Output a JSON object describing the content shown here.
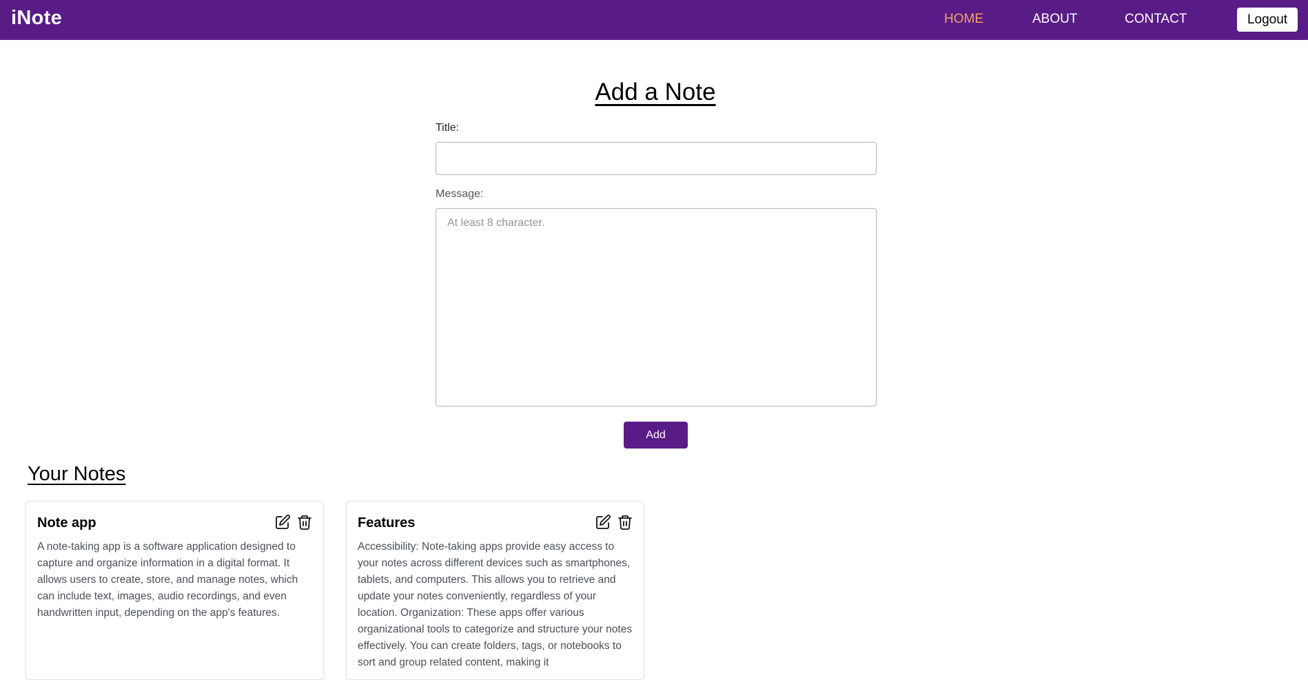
{
  "navbar": {
    "brand": "iNote",
    "links": [
      "HOME",
      "ABOUT",
      "CONTACT"
    ],
    "active_link": "HOME",
    "logout_label": "Logout"
  },
  "form": {
    "heading": "Add a Note",
    "title_label": "Title:",
    "title_value": "",
    "message_label": "Message:",
    "message_placeholder": "At least 8 character.",
    "add_label": "Add"
  },
  "notes": {
    "heading": "Your Notes",
    "items": [
      {
        "title": "Note app",
        "body": "A note-taking app is a software application designed to capture and organize information in a digital format. It allows users to create, store, and manage notes, which can include text, images, audio recordings, and even handwritten input, depending on the app's features."
      },
      {
        "title": "Features",
        "body": "Accessibility: Note-taking apps provide easy access to your notes across different devices such as smartphones, tablets, and computers. This allows you to retrieve and update your notes conveniently, regardless of your location. Organization: These apps offer various organizational tools to categorize and structure your notes effectively. You can create folders, tags, or notebooks to sort and group related content, making it"
      }
    ]
  },
  "icons": {
    "edit": "edit-icon",
    "delete": "trash-icon"
  },
  "colors": {
    "primary": "#591c87",
    "active_link": "#f4a261"
  }
}
